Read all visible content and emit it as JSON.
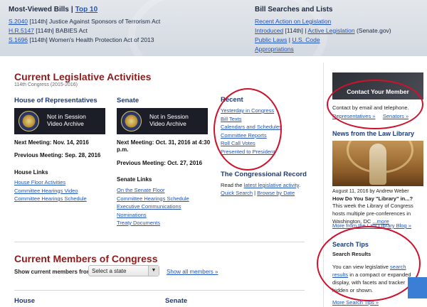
{
  "most_viewed": {
    "title": "Most-Viewed Bills",
    "separator": "|",
    "top10": "Top 10",
    "bills": [
      {
        "id": "S.2040",
        "text": "[114th] Justice Against Sponsors of Terrorism Act"
      },
      {
        "id": "H.R.5147",
        "text": "[114th] BABIES Act"
      },
      {
        "id": "S.1696",
        "text": "[114th] Women's Health Protection Act of 2013"
      }
    ]
  },
  "bill_searches": {
    "title": "Bill Searches and Lists",
    "recent": "Recent Action on Legislation",
    "introduced": "Introduced",
    "congress_tag": "[114th]",
    "pipe": "|",
    "active": "Active Legislation",
    "senate_gov": "(Senate.gov)",
    "public_laws": "Public Laws",
    "us_code": "U.S. Code",
    "appropriations": "Appropriations"
  },
  "cla": {
    "title": "Current Legislative Activities",
    "subtitle": "114th Congress (2015-2016)"
  },
  "house": {
    "heading": "House of Representatives",
    "video_line1": "Not in Session",
    "video_line2": "Video Archive",
    "next": "Next Meeting: Nov. 14, 2016",
    "prev": "Previous Meeting: Sep. 28, 2016",
    "links_heading": "House Links",
    "links": [
      "House Floor Activities",
      "Committee Hearings Video",
      "Committee Hearings Schedule"
    ]
  },
  "senate": {
    "heading": "Senate",
    "video_line1": "Not in Session",
    "video_line2": "Video Archive",
    "next_line1": "Next Meeting: Oct. 31, 2016 at 4:30",
    "next_line2": "p.m.",
    "prev": "Previous Meeting: Oct. 27, 2016",
    "links_heading": "Senate Links",
    "links": [
      "On the Senate Floor",
      "Committee Hearings Schedule",
      "Executive Communications",
      "Nominations",
      "Treaty Documents"
    ]
  },
  "recent": {
    "heading": "Recent",
    "items": [
      "Yesterday in Congress",
      "Bill Texts",
      "Calendars and Schedules",
      "Committee Reports",
      "Roll Call Votes",
      "Presented to President"
    ]
  },
  "record": {
    "heading": "The Congressional Record",
    "read_the": "Read the",
    "latest": "latest legislative activity",
    "period": ".",
    "quick": "Quick Search",
    "pipe": "|",
    "browse": "Browse by Date"
  },
  "members": {
    "title": "Current Members of Congress",
    "show_label": "Show current members from:",
    "select_value": "Select a state",
    "show_all": "Show all members »",
    "house": "House",
    "senate": "Senate"
  },
  "sidebar": {
    "contact_title": "Contact Your Member",
    "contact_text": "Contact by email and telephone.",
    "reps": "Representatives »",
    "senators": "Senators »",
    "news_heading": "News from the Law Library",
    "post_meta": "August 11, 2016 by Andrew Weber",
    "post_title": "How Do You Say \"Library\" in...?",
    "post_text": "This week the Library of Congress hosts multiple pre-conferences in Washington, DC",
    "more": "...more",
    "blog": "More from the Law Library Blog »",
    "tips_heading": "Search Tips",
    "tips_sub": "Search Results",
    "tips_text1": "You can view legislative",
    "tips_link": "search results",
    "tips_text2": "in a compact or expanded display, with facets and tracker hidden or shown.",
    "more_tips": "More Search Tips »"
  },
  "colors": {
    "accent_red": "#8c1c1c",
    "heading_blue": "#1d3b7a",
    "link": "#2054b8",
    "annotation": "#d0112b"
  }
}
